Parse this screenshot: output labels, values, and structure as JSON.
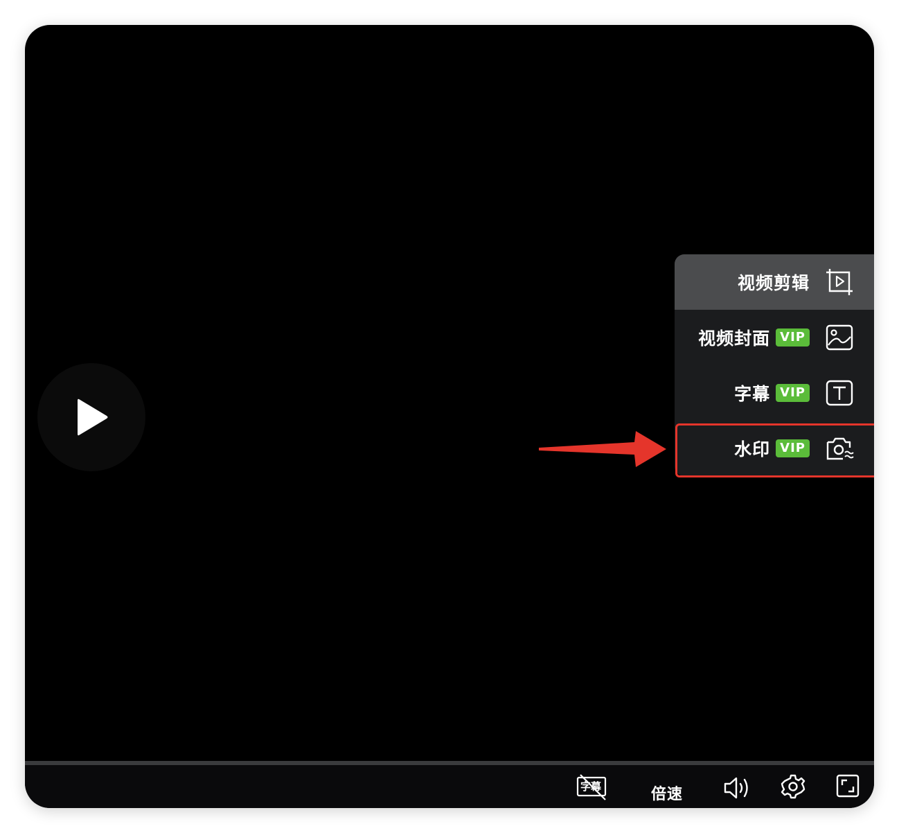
{
  "menu": {
    "items": [
      {
        "label": "视频剪辑",
        "vip": null,
        "icon": "video-edit-icon"
      },
      {
        "label": "视频封面",
        "vip": "VIP",
        "icon": "image-icon"
      },
      {
        "label": "字幕",
        "vip": "VIP",
        "icon": "text-icon"
      },
      {
        "label": "水印",
        "vip": "VIP",
        "icon": "camera-watermark-icon"
      }
    ],
    "active_index": 0,
    "highlighted_index": 3
  },
  "controls": {
    "subtitle_toggle_label": "字幕",
    "speed_label": "倍速"
  },
  "colors": {
    "vip_badge": "#5bbc3a",
    "highlight": "#e5352b",
    "player_bg": "#000000"
  },
  "icons": [
    "play-icon",
    "subtitle-off-icon",
    "volume-icon",
    "gear-icon",
    "fullscreen-icon"
  ]
}
